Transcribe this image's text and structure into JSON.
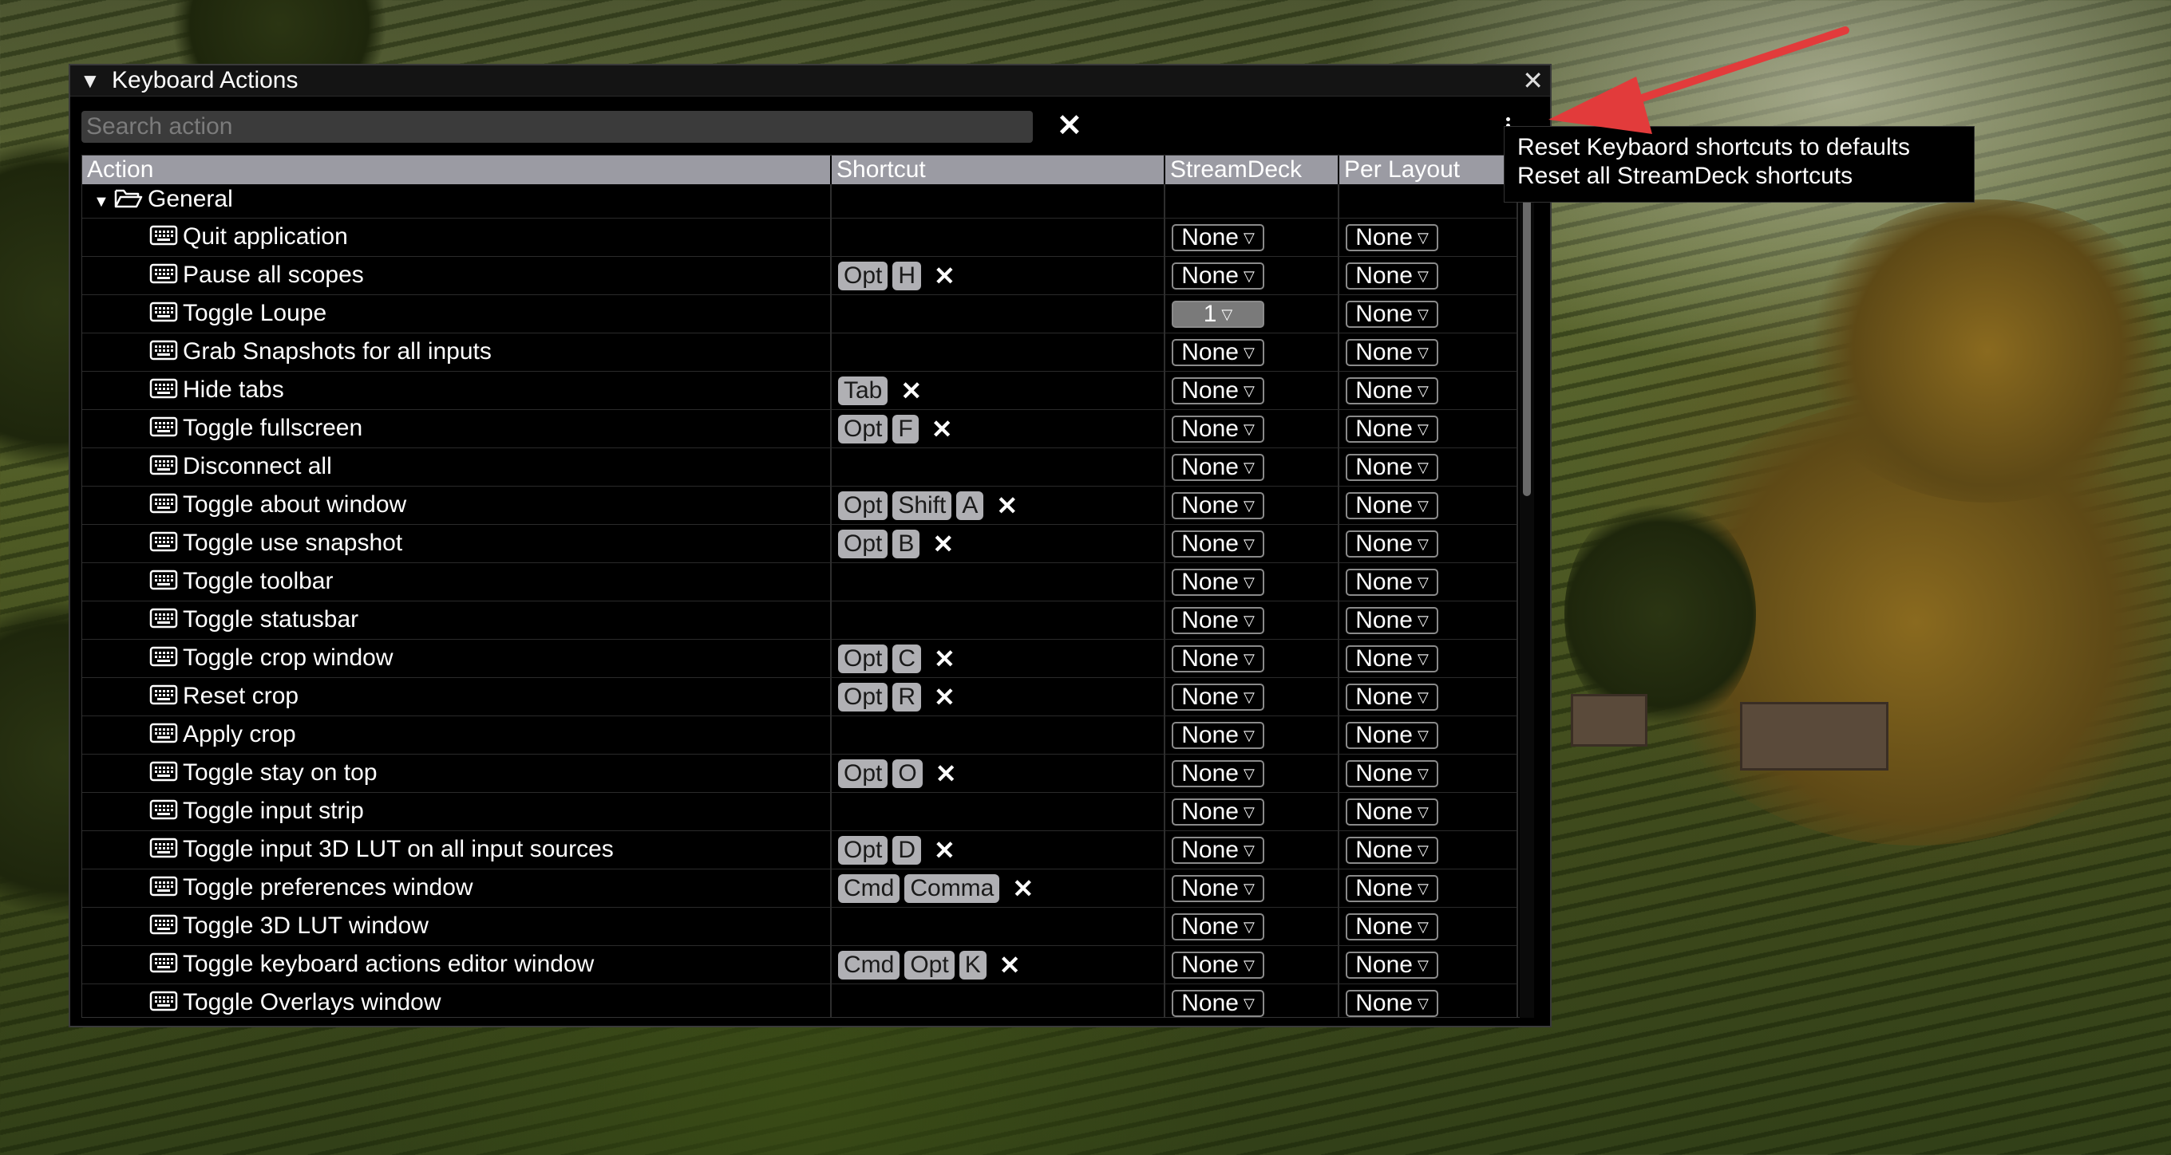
{
  "window": {
    "title": "Keyboard Actions"
  },
  "search": {
    "placeholder": "Search action",
    "value": ""
  },
  "columns": [
    "Action",
    "Shortcut",
    "StreamDeck",
    "Per Layout"
  ],
  "group": {
    "name": "General"
  },
  "actions": [
    {
      "label": "Quit application",
      "keys": [],
      "streamdeck": "None",
      "per_layout": "None"
    },
    {
      "label": "Pause all scopes",
      "keys": [
        "Opt",
        "H"
      ],
      "streamdeck": "None",
      "per_layout": "None"
    },
    {
      "label": "Toggle Loupe",
      "keys": [],
      "streamdeck": "1",
      "per_layout": "None"
    },
    {
      "label": "Grab Snapshots for all inputs",
      "keys": [],
      "streamdeck": "None",
      "per_layout": "None"
    },
    {
      "label": "Hide tabs",
      "keys": [
        "Tab"
      ],
      "streamdeck": "None",
      "per_layout": "None"
    },
    {
      "label": "Toggle fullscreen",
      "keys": [
        "Opt",
        "F"
      ],
      "streamdeck": "None",
      "per_layout": "None"
    },
    {
      "label": "Disconnect all",
      "keys": [],
      "streamdeck": "None",
      "per_layout": "None"
    },
    {
      "label": "Toggle about window",
      "keys": [
        "Opt",
        "Shift",
        "A"
      ],
      "streamdeck": "None",
      "per_layout": "None"
    },
    {
      "label": "Toggle use snapshot",
      "keys": [
        "Opt",
        "B"
      ],
      "streamdeck": "None",
      "per_layout": "None"
    },
    {
      "label": "Toggle toolbar",
      "keys": [],
      "streamdeck": "None",
      "per_layout": "None"
    },
    {
      "label": "Toggle statusbar",
      "keys": [],
      "streamdeck": "None",
      "per_layout": "None"
    },
    {
      "label": "Toggle crop window",
      "keys": [
        "Opt",
        "C"
      ],
      "streamdeck": "None",
      "per_layout": "None"
    },
    {
      "label": "Reset crop",
      "keys": [
        "Opt",
        "R"
      ],
      "streamdeck": "None",
      "per_layout": "None"
    },
    {
      "label": "Apply crop",
      "keys": [],
      "streamdeck": "None",
      "per_layout": "None"
    },
    {
      "label": "Toggle stay on top",
      "keys": [
        "Opt",
        "O"
      ],
      "streamdeck": "None",
      "per_layout": "None"
    },
    {
      "label": "Toggle input strip",
      "keys": [],
      "streamdeck": "None",
      "per_layout": "None"
    },
    {
      "label": "Toggle input 3D LUT on all input sources",
      "keys": [
        "Opt",
        "D"
      ],
      "streamdeck": "None",
      "per_layout": "None"
    },
    {
      "label": "Toggle preferences window",
      "keys": [
        "Cmd",
        "Comma"
      ],
      "streamdeck": "None",
      "per_layout": "None"
    },
    {
      "label": "Toggle 3D LUT window",
      "keys": [],
      "streamdeck": "None",
      "per_layout": "None"
    },
    {
      "label": "Toggle keyboard actions editor window",
      "keys": [
        "Cmd",
        "Opt",
        "K"
      ],
      "streamdeck": "None",
      "per_layout": "None"
    },
    {
      "label": "Toggle Overlays window",
      "keys": [],
      "streamdeck": "None",
      "per_layout": "None"
    }
  ],
  "context_menu": {
    "items": [
      "Reset Keybaord shortcuts to defaults",
      "Reset all StreamDeck shortcuts"
    ]
  },
  "colors": {
    "header_bg": "#9b9ba3",
    "key_bg": "#b0b0b4",
    "annotation_arrow": "#e23b3b"
  },
  "icons": {
    "collapse": "triangle-down-icon",
    "close": "close-icon",
    "clear": "x-icon",
    "menu": "kebab-icon",
    "folder": "folder-open-icon",
    "action": "keyboard-icon",
    "dropdown": "chevron-down-icon"
  }
}
